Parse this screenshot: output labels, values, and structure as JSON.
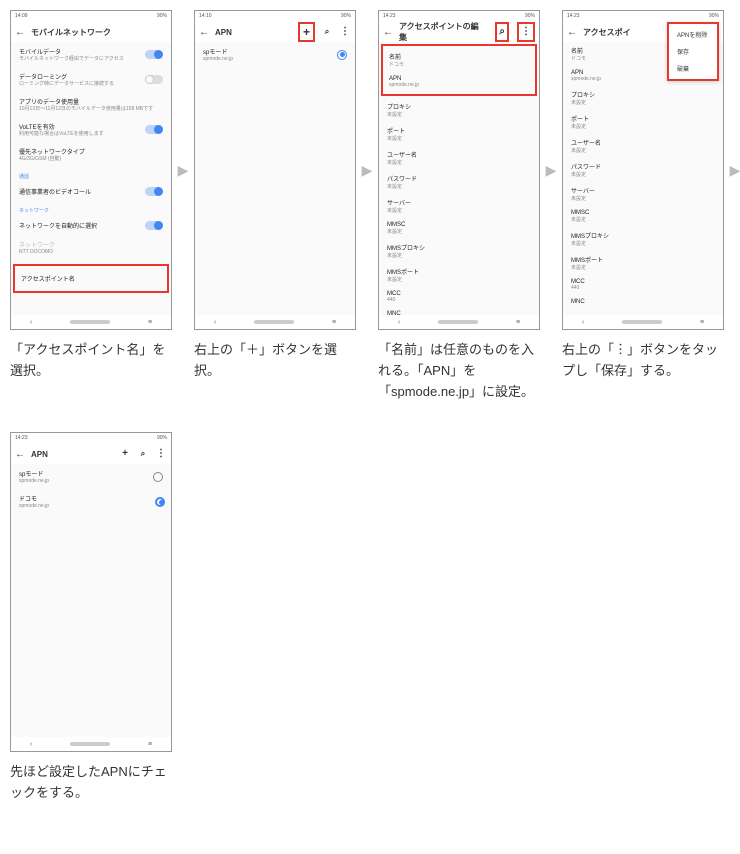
{
  "status": {
    "time1": "14:09",
    "time2": "14:10",
    "time3": "14:23",
    "battext": "90%",
    "icons": "⬚ ⌂ ⬚ ☒"
  },
  "s1": {
    "title": "モバイルネットワーク",
    "mobile_data": "モバイルデータ",
    "mobile_data_sub": "モバイルネットワーク経由でデータにアクセス",
    "roaming": "データローミング",
    "roaming_sub": "ローミング時にデータサービスに接続する",
    "app_usage": "アプリのデータ使用量",
    "app_usage_sub": "10月13日〜11月12日のモバイルデータ使用量は158 MBです",
    "volte": "VoLTEを有効",
    "volte_sub": "利用可能な場合はVoLTEを使用します",
    "net_type": "優先ネットワークタイプ",
    "net_type_sub": "4G/3G/GSM (自動)",
    "call_hdr": "通話",
    "video_call": "通信事業者のビデオコール",
    "net_hdr": "ネットワーク",
    "auto_select": "ネットワークを自動的に選択",
    "net_disabled": "ネットワーク",
    "net_disabled_sub": "NTT DOCOMO",
    "apn": "アクセスポイント名",
    "caption": "「アクセスポイント名」を選択。"
  },
  "s2": {
    "title": "APN",
    "entry": "spモード",
    "entry_sub": "spmode.ne.jp",
    "caption": "右上の「＋」ボタンを選択。"
  },
  "s3": {
    "title": "アクセスポイントの編集",
    "name_lbl": "名前",
    "name_val": "ドコモ",
    "apn_lbl": "APN",
    "apn_val": "spmode.ne.jp",
    "proxy": "プロキシ",
    "unset": "未設定",
    "port": "ポート",
    "user": "ユーザー名",
    "pass": "パスワード",
    "server": "サーバー",
    "mmsc": "MMSC",
    "mms_proxy": "MMSプロキシ",
    "mms_port": "MMSポート",
    "mcc": "MCC",
    "mcc_val": "440",
    "mnc": "MNC",
    "caption": "「名前」は任意のものを入れる。「APN」を「spmode.ne.jp」に設定。"
  },
  "s4": {
    "title": "アクセスポイ",
    "menu_delete": "APNを削除",
    "menu_save": "保存",
    "menu_discard": "破棄",
    "caption": "右上の「︙」ボタンをタップし「保存」する。"
  },
  "s5": {
    "title": "APN",
    "e1": "spモード",
    "e1_sub": "spmode.ne.jp",
    "e2": "ドコモ",
    "e2_sub": "spmode.ne.jp",
    "caption": "先ほど設定したAPNにチェックをする。"
  }
}
